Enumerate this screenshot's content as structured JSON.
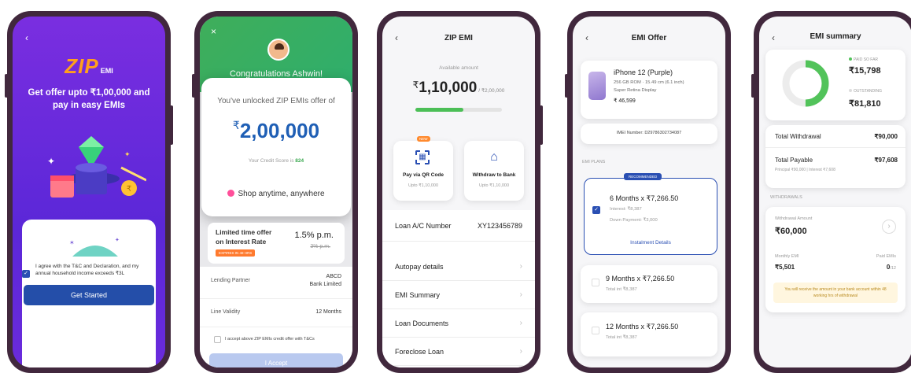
{
  "colors": {
    "purple": "#7b2bdc",
    "blue": "#2a4fb3",
    "green": "#52c35a",
    "orange": "#ff7a2e",
    "frame": "#41283d"
  },
  "s1": {
    "back": "‹",
    "brand": "ZIP",
    "brand_sub": "EMI",
    "headline1": "Get offer upto ₹1,00,000 and",
    "headline2": "pay in easy EMIs",
    "agree": "I agree with the T&C and Declaration, and my annual household income exceeds ₹3L",
    "cta": "Get Started"
  },
  "s2": {
    "close": "×",
    "congrats": "Congratulations Ashwin!",
    "unlocked": "You've unlocked ZIP EMIs offer of",
    "rupee": "₹",
    "amount": "2,00,000",
    "score_label": "Your Credit Score is",
    "score": "824",
    "shop": "Shop anytime, anywhere",
    "offer_title1": "Limited time offer",
    "offer_title2": "on Interest Rate",
    "rate": "1.5% p.m.",
    "old_rate": "3% p.m.",
    "expiry": "EXPIRES IN 48 HRS",
    "lp_label": "Lending Partner",
    "lp_value1": "ABCD",
    "lp_value2": "Bank Limited",
    "lv_label": "Line Validity",
    "lv_value": "12 Months",
    "accept": "I accept above ZIP EMIs credit offer with T&Cs",
    "accept_btn": "I Accept"
  },
  "s3": {
    "title": "ZIP EMI",
    "back": "‹",
    "avail_label": "Available amount",
    "rupee": "₹",
    "amount": "1,10,000",
    "total": "/ ₹2,00,000",
    "progress": 0.55,
    "new_badge": "NEW",
    "qr_title": "Pay via QR Code",
    "qr_sub": "Upto ₹1,10,000",
    "wd_title": "Withdraw to Bank",
    "wd_sub": "Upto ₹1,10,000",
    "loan_label": "Loan A/C Number",
    "loan_value": "XY123456789",
    "menu": [
      "Autopay details",
      "EMI Summary",
      "Loan Documents",
      "Foreclose Loan"
    ]
  },
  "s4": {
    "title": "EMI Offer",
    "back": "‹",
    "product": "iPhone 12 (Purple)",
    "spec1": "256 GB ROM · 15.49 cm (6.1 inch)",
    "spec2": "Super Retina Display",
    "price": "₹ 46,599",
    "imei": "IMEI Number: D29786302734087",
    "plans_label": "EMI PLANS",
    "recommended": "RECOMMENDED",
    "p1_title": "6 Months x ₹7,266.50",
    "p1_interest": "Interest: ₹8,387",
    "p1_down": "Down Payment: ₹3,000",
    "p1_link": "Instalment Details",
    "p2_title": "9 Months x ₹7,266.50",
    "p2_sub": "Total int ₹8,387",
    "p3_title": "12 Months x ₹7,266.50",
    "p3_sub": "Total int ₹8,387"
  },
  "s5": {
    "title": "EMI summary",
    "back": "‹",
    "paid_label": "PAID SO FAR",
    "paid": "₹15,798",
    "out_label": "OUTSTANDING",
    "outstanding": "₹81,810",
    "paid_fraction": 0.16,
    "tw_label": "Total Withdrawal",
    "tw_value": "₹90,000",
    "tp_label": "Total Payable",
    "tp_value": "₹97,608",
    "tp_sub": "Principal ₹90,000 | Interest ₹7,608",
    "wd_section": "WITHDRAWALS",
    "wa_label": "Withdrawal Amount",
    "wa_value": "₹60,000",
    "me_label": "Monthly EMI",
    "me_value": "₹5,501",
    "pe_label": "Paid EMIs",
    "pe_value": "0",
    "pe_total": "/12",
    "note": "You will receive the amount in your bank account within 48 working hrs of withdrawal"
  }
}
